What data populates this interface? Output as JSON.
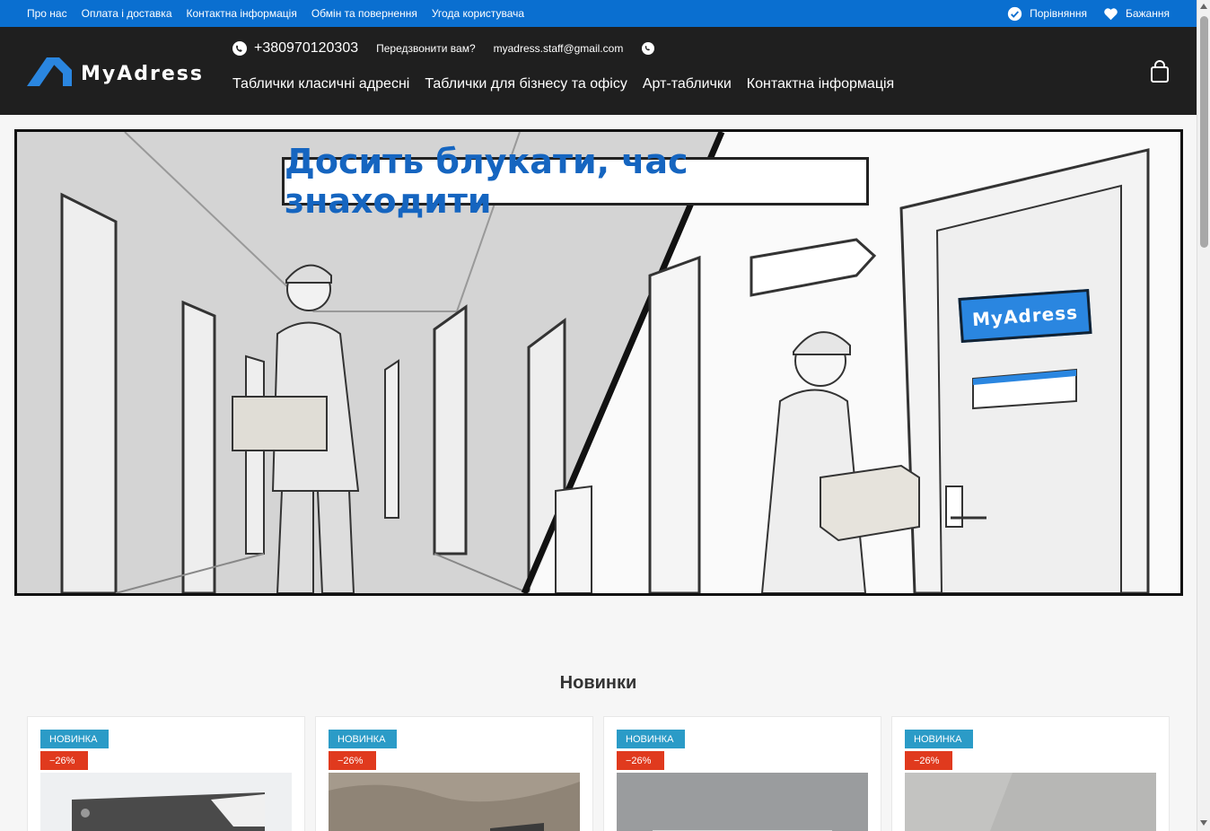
{
  "topbar": {
    "links": [
      "Про нас",
      "Оплата і доставка",
      "Контактна інформація",
      "Обмін та повернення",
      "Угода користувача"
    ],
    "compare_label": "Порівняння",
    "wishlist_label": "Бажання"
  },
  "header": {
    "logo_text": "MyAdress",
    "phone": "+380970120303",
    "callback": "Передзвонити вам?",
    "email": "myadress.staff@gmail.com",
    "nav": [
      "Таблички класичні адресні",
      "Таблички для бізнесу та офісу",
      "Арт-таблички",
      "Контактна інформація"
    ]
  },
  "hero": {
    "headline": "Досить блукати, час  знаходити",
    "door_sign": "MyAdress"
  },
  "section": {
    "title": "Новинки"
  },
  "products": [
    {
      "badge_new": "НОВИНКА",
      "badge_sale": "−26%"
    },
    {
      "badge_new": "НОВИНКА",
      "badge_sale": "−26%"
    },
    {
      "badge_new": "НОВИНКА",
      "badge_sale": "−26%"
    },
    {
      "badge_new": "НОВИНКА",
      "badge_sale": "−26%"
    }
  ],
  "colors": {
    "topbar": "#0a6fd0",
    "header": "#1f1f1f",
    "badge_new": "#2b9bc7",
    "badge_sale": "#e03a1e",
    "headline": "#1565c0"
  }
}
